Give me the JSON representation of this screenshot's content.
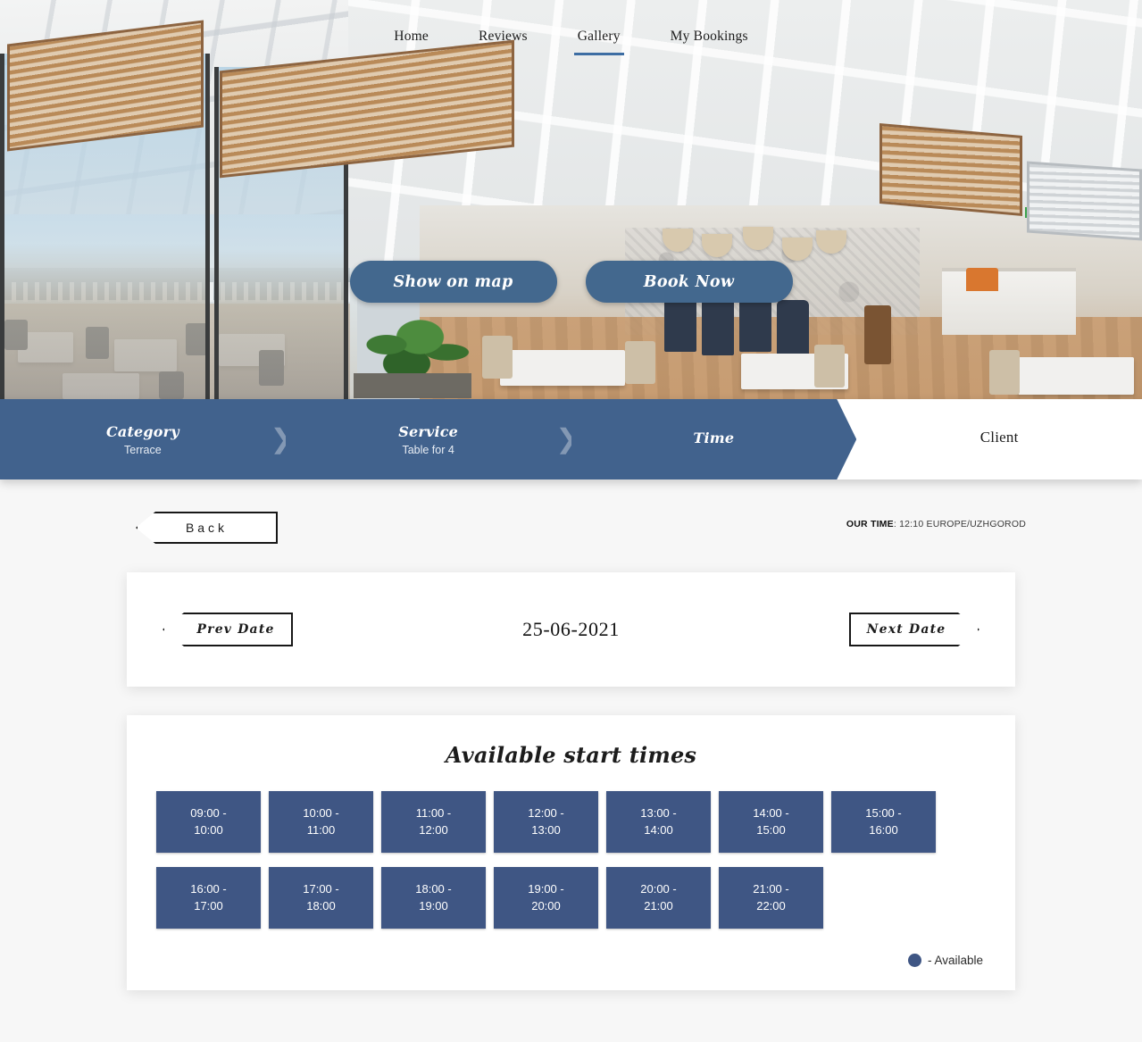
{
  "nav": {
    "items": [
      {
        "label": "Home",
        "active": false
      },
      {
        "label": "Reviews",
        "active": false
      },
      {
        "label": "Gallery",
        "active": true
      },
      {
        "label": "My Bookings",
        "active": false
      }
    ]
  },
  "hero": {
    "show_on_map_label": "Show on map",
    "book_now_label": "Book Now"
  },
  "stepper": {
    "steps": [
      {
        "title": "Category",
        "sub": "Terrace",
        "state": "done"
      },
      {
        "title": "Service",
        "sub": "Table for 4",
        "state": "done"
      },
      {
        "title": "Time",
        "sub": "",
        "state": "current"
      },
      {
        "title": "Client",
        "sub": "",
        "state": "upcoming"
      }
    ]
  },
  "toolbar": {
    "back_label": "Back",
    "our_time_label": "OUR TIME",
    "our_time_value": "12:10 EUROPE/UZHGOROD"
  },
  "date_nav": {
    "prev_label": "Prev Date",
    "next_label": "Next Date",
    "current_date": "25-06-2021"
  },
  "times": {
    "title": "Available start times",
    "slots": [
      {
        "start": "09:00 -",
        "end": "10:00"
      },
      {
        "start": "10:00 -",
        "end": "11:00"
      },
      {
        "start": "11:00 -",
        "end": "12:00"
      },
      {
        "start": "12:00 -",
        "end": "13:00"
      },
      {
        "start": "13:00 -",
        "end": "14:00"
      },
      {
        "start": "14:00 -",
        "end": "15:00"
      },
      {
        "start": "15:00 -",
        "end": "16:00"
      },
      {
        "start": "16:00 -",
        "end": "17:00"
      },
      {
        "start": "17:00 -",
        "end": "18:00"
      },
      {
        "start": "18:00 -",
        "end": "19:00"
      },
      {
        "start": "19:00 -",
        "end": "20:00"
      },
      {
        "start": "20:00 -",
        "end": "21:00"
      },
      {
        "start": "21:00 -",
        "end": "22:00"
      }
    ],
    "legend_text": "- Available"
  },
  "colors": {
    "primary_blue": "#41628d",
    "slot_blue": "#3f5684",
    "cta_blue": "#43688e",
    "page_bg": "#f7f7f7"
  }
}
